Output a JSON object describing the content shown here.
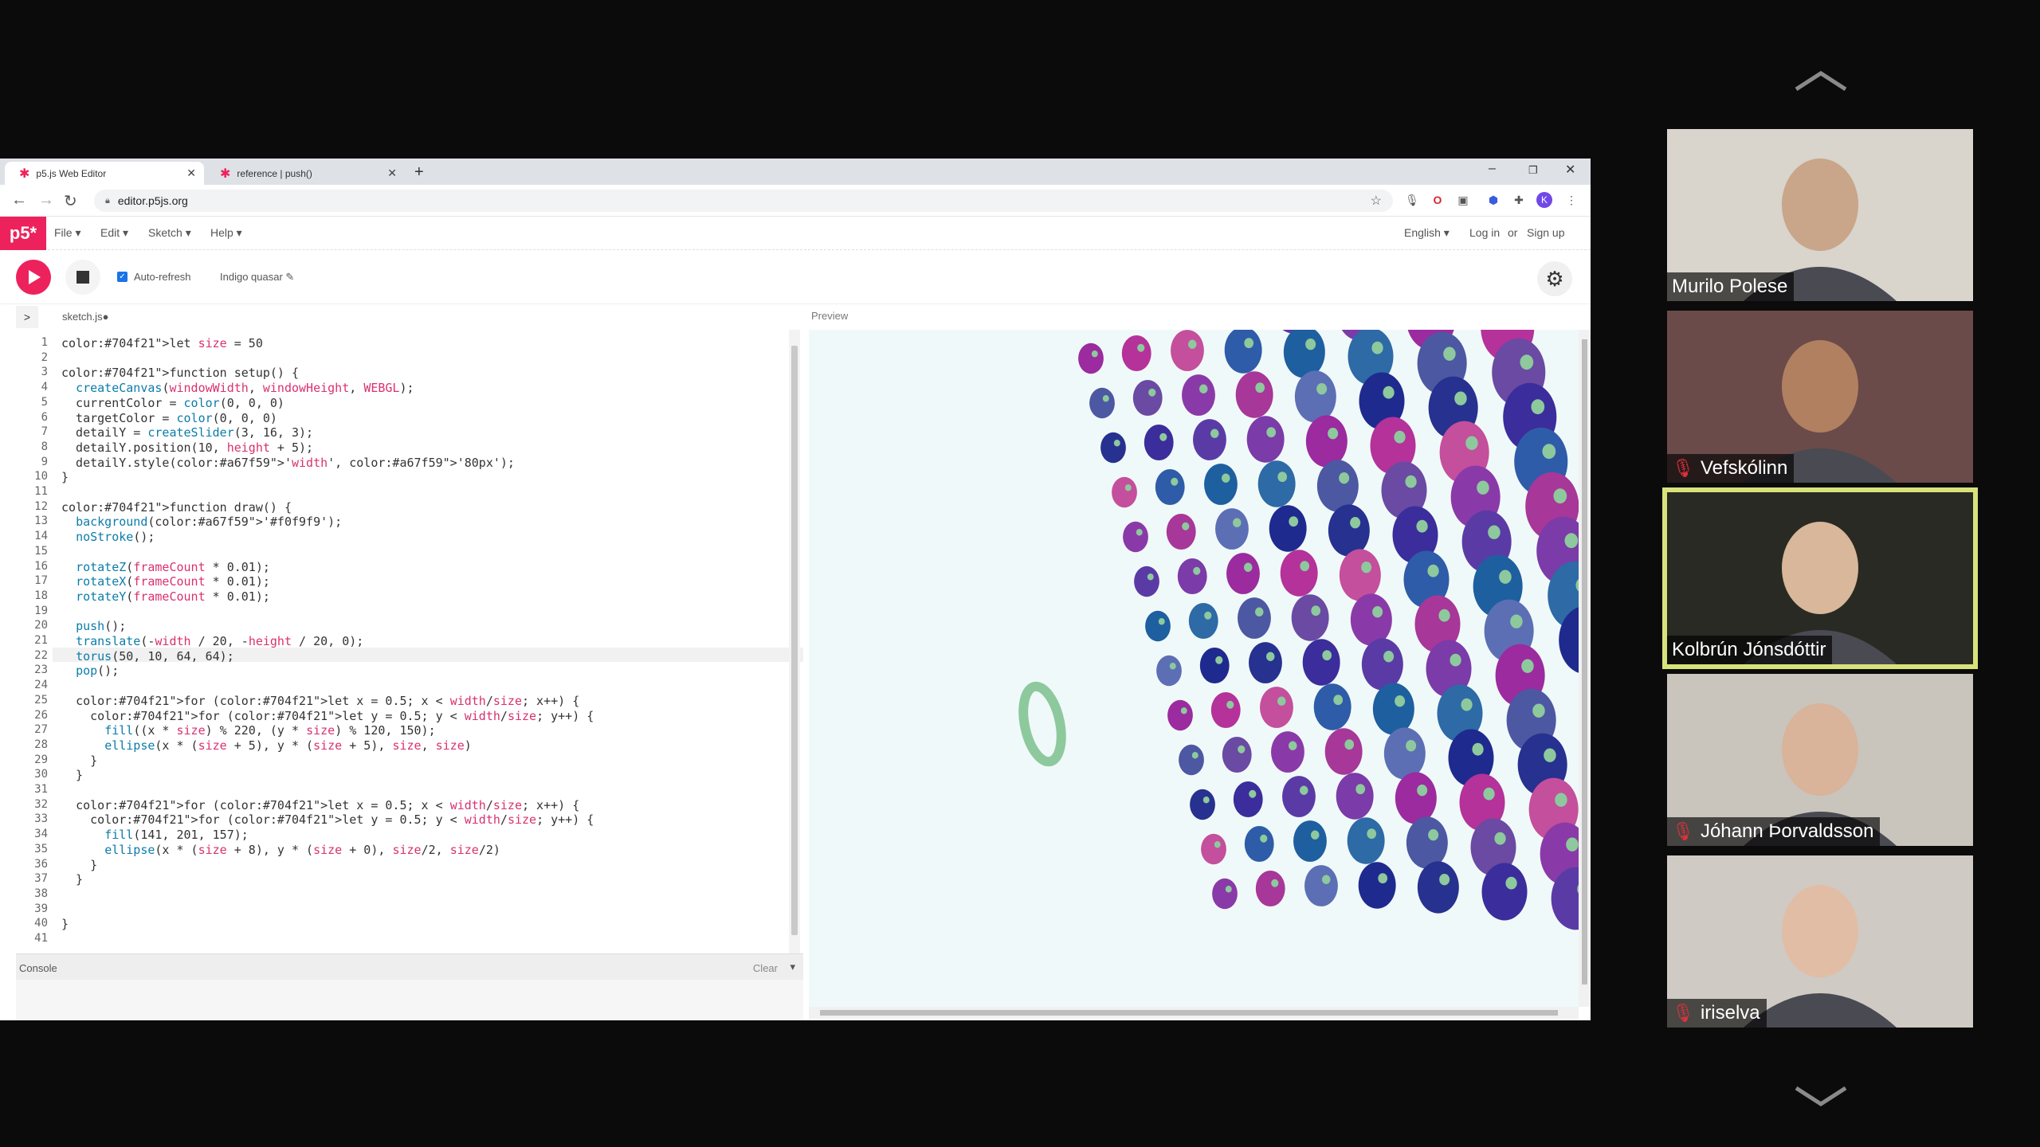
{
  "browser": {
    "tabs": [
      {
        "label": "p5.js Web Editor",
        "active": true
      },
      {
        "label": "reference | push()",
        "active": false
      }
    ],
    "url": "editor.p5js.org"
  },
  "p5": {
    "logo": "p5*",
    "menus": [
      "File ▾",
      "Edit ▾",
      "Sketch ▾",
      "Help ▾"
    ],
    "language": "English ▾",
    "login": "Log in",
    "or": "or",
    "signup": "Sign up",
    "auto_refresh": "Auto-refresh",
    "sketch_name": "Indigo quasar ✎",
    "file_name": "sketch.js●",
    "preview_label": "Preview",
    "console_label": "Console",
    "clear_label": "Clear"
  },
  "code_lines": [
    "let size = 50",
    "",
    "function setup() {",
    "  createCanvas(windowWidth, windowHeight, WEBGL);",
    "  currentColor = color(0, 0, 0)",
    "  targetColor = color(0, 0, 0)",
    "  detailY = createSlider(3, 16, 3);",
    "  detailY.position(10, height + 5);",
    "  detailY.style('width', '80px');",
    "}",
    "",
    "function draw() {",
    "  background('#f0f9f9');",
    "  noStroke();",
    "",
    "  rotateZ(frameCount * 0.01);",
    "  rotateX(frameCount * 0.01);",
    "  rotateY(frameCount * 0.01);",
    "",
    "  push();",
    "  translate(-width / 20, -height / 20, 0);",
    "  torus(50, 10, 64, 64);",
    "  pop();",
    "",
    "  for (let x = 0.5; x < width/size; x++) {",
    "    for (let y = 0.5; y < width/size; y++) {",
    "      fill((x * size) % 220, (y * size) % 120, 150);",
    "      ellipse(x * (size + 5), y * (size + 5), size, size)",
    "    }",
    "  }",
    "",
    "  for (let x = 0.5; x < width/size; x++) {",
    "    for (let y = 0.5; y < width/size; y++) {",
    "      fill(141, 201, 157);",
    "      ellipse(x * (size + 8), y * (size + 0), size/2, size/2)",
    "    }",
    "  }",
    "",
    "",
    "}",
    ""
  ],
  "active_line": 22,
  "participants": [
    {
      "name": "Murilo Polese",
      "muted": false,
      "active": false,
      "bg": "#d9d4cc",
      "skin": "#c9a58a"
    },
    {
      "name": "Vefskólinn",
      "muted": true,
      "active": false,
      "bg": "#6b4a4a",
      "skin": "#b08060"
    },
    {
      "name": "Kolbrún Jónsdóttir",
      "muted": false,
      "active": true,
      "bg": "#2a2a24",
      "skin": "#d8b79a"
    },
    {
      "name": "Jóhann Þorvaldsson",
      "muted": true,
      "active": false,
      "bg": "#c9c4bc",
      "skin": "#d9b39a"
    },
    {
      "name": "iriselva",
      "muted": true,
      "active": false,
      "bg": "#cfcac3",
      "skin": "#e2bda5"
    }
  ],
  "colors": {
    "accent": "#ed225d",
    "canvas_bg": "#f0f9f9",
    "mint": "#8dc99d",
    "active_speaker": "#d8e27b"
  }
}
